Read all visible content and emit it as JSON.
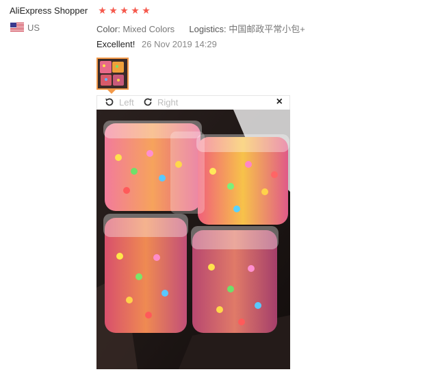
{
  "review": {
    "author": "AliExpress Shopper",
    "rating": 5,
    "country": "US",
    "color_label": "Color:",
    "color_value": "Mixed Colors",
    "logistics_label": "Logistics:",
    "logistics_value": "中国邮政平常小包+",
    "feedback": "Excellent!",
    "date": "26 Nov 2019 14:29"
  },
  "viewer": {
    "rotate_left_label": "Left",
    "rotate_right_label": "Right",
    "close_glyph": "×"
  },
  "icons": {
    "star": "star-icon",
    "flag": "us-flag-icon",
    "rotate_left": "rotate-left-icon",
    "rotate_right": "rotate-right-icon",
    "close": "close-icon"
  },
  "colors": {
    "star": "#f5584c",
    "thumb_border": "#f39a4a",
    "muted_text": "#777777"
  }
}
